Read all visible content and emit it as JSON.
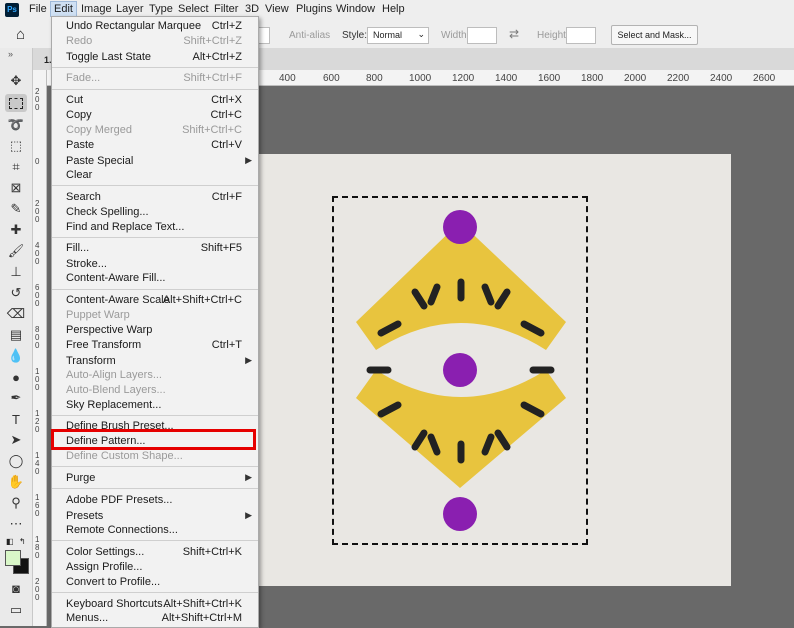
{
  "menubar": {
    "logo": "Ps",
    "items": [
      "File",
      "Edit",
      "Image",
      "Layer",
      "Type",
      "Select",
      "Filter",
      "3D",
      "View",
      "Plugins",
      "Window",
      "Help"
    ]
  },
  "options": {
    "antialias": "Anti-alias",
    "style_label": "Style:",
    "style_value": "Normal",
    "width_label": "Width:",
    "height_label": "Height:",
    "select_mask": "Select and Mask..."
  },
  "ruler": {
    "h_ticks": [
      "400",
      "600",
      "800",
      "1000",
      "1200",
      "1400",
      "1600",
      "1800",
      "2000",
      "2200",
      "2400",
      "2600"
    ],
    "tab_prefix": "1."
  },
  "edit_menu": {
    "undo": {
      "label": "Undo Rectangular Marquee",
      "shortcut": "Ctrl+Z"
    },
    "redo": {
      "label": "Redo",
      "shortcut": "Shift+Ctrl+Z"
    },
    "toggle_last": {
      "label": "Toggle Last State",
      "shortcut": "Alt+Ctrl+Z"
    },
    "fade": {
      "label": "Fade...",
      "shortcut": "Shift+Ctrl+F"
    },
    "cut": {
      "label": "Cut",
      "shortcut": "Ctrl+X"
    },
    "copy": {
      "label": "Copy",
      "shortcut": "Ctrl+C"
    },
    "copy_merged": {
      "label": "Copy Merged",
      "shortcut": "Shift+Ctrl+C"
    },
    "paste": {
      "label": "Paste",
      "shortcut": "Ctrl+V"
    },
    "paste_special": {
      "label": "Paste Special"
    },
    "clear": {
      "label": "Clear"
    },
    "search": {
      "label": "Search",
      "shortcut": "Ctrl+F"
    },
    "check_spelling": {
      "label": "Check Spelling..."
    },
    "find_replace": {
      "label": "Find and Replace Text..."
    },
    "fill": {
      "label": "Fill...",
      "shortcut": "Shift+F5"
    },
    "stroke": {
      "label": "Stroke..."
    },
    "content_aware_fill": {
      "label": "Content-Aware Fill..."
    },
    "content_aware_scale": {
      "label": "Content-Aware Scale",
      "shortcut": "Alt+Shift+Ctrl+C"
    },
    "puppet_warp": {
      "label": "Puppet Warp"
    },
    "perspective_warp": {
      "label": "Perspective Warp"
    },
    "free_transform": {
      "label": "Free Transform",
      "shortcut": "Ctrl+T"
    },
    "transform": {
      "label": "Transform"
    },
    "auto_align": {
      "label": "Auto-Align Layers..."
    },
    "auto_blend": {
      "label": "Auto-Blend Layers..."
    },
    "sky_replacement": {
      "label": "Sky Replacement..."
    },
    "define_brush": {
      "label": "Define Brush Preset..."
    },
    "define_pattern": {
      "label": "Define Pattern..."
    },
    "define_custom_shape": {
      "label": "Define Custom Shape..."
    },
    "purge": {
      "label": "Purge"
    },
    "pdf_presets": {
      "label": "Adobe PDF Presets..."
    },
    "presets": {
      "label": "Presets"
    },
    "remote_connections": {
      "label": "Remote Connections..."
    },
    "color_settings": {
      "label": "Color Settings...",
      "shortcut": "Shift+Ctrl+K"
    },
    "assign_profile": {
      "label": "Assign Profile..."
    },
    "convert_profile": {
      "label": "Convert to Profile..."
    },
    "keyboard_shortcuts": {
      "label": "Keyboard Shortcuts...",
      "shortcut": "Alt+Shift+Ctrl+K"
    },
    "menus": {
      "label": "Menus...",
      "shortcut": "Alt+Shift+Ctrl+M"
    }
  },
  "colors": {
    "highlight_border": "#e60000",
    "ps_blue": "#31a8ff",
    "shape_yellow": "#e8c43e",
    "bead_purple": "#8a1fb0"
  }
}
